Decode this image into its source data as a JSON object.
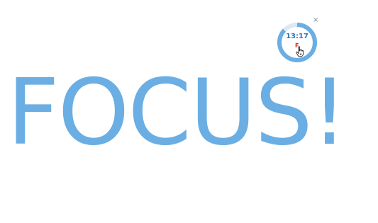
{
  "main": {
    "focus_text": "FOCUS!"
  },
  "timer": {
    "time": "13:17",
    "remaining_fraction": 0.87,
    "ring_color": "#6aaee3",
    "track_color": "#d9e9f6",
    "text_color": "#2e75b6",
    "stop_label": "F",
    "stop_color": "#e02020",
    "close_label": "×",
    "cursor_icon": "hand-pointer-icon"
  },
  "colors": {
    "focus": "#6aaee3",
    "background": "#ffffff"
  }
}
